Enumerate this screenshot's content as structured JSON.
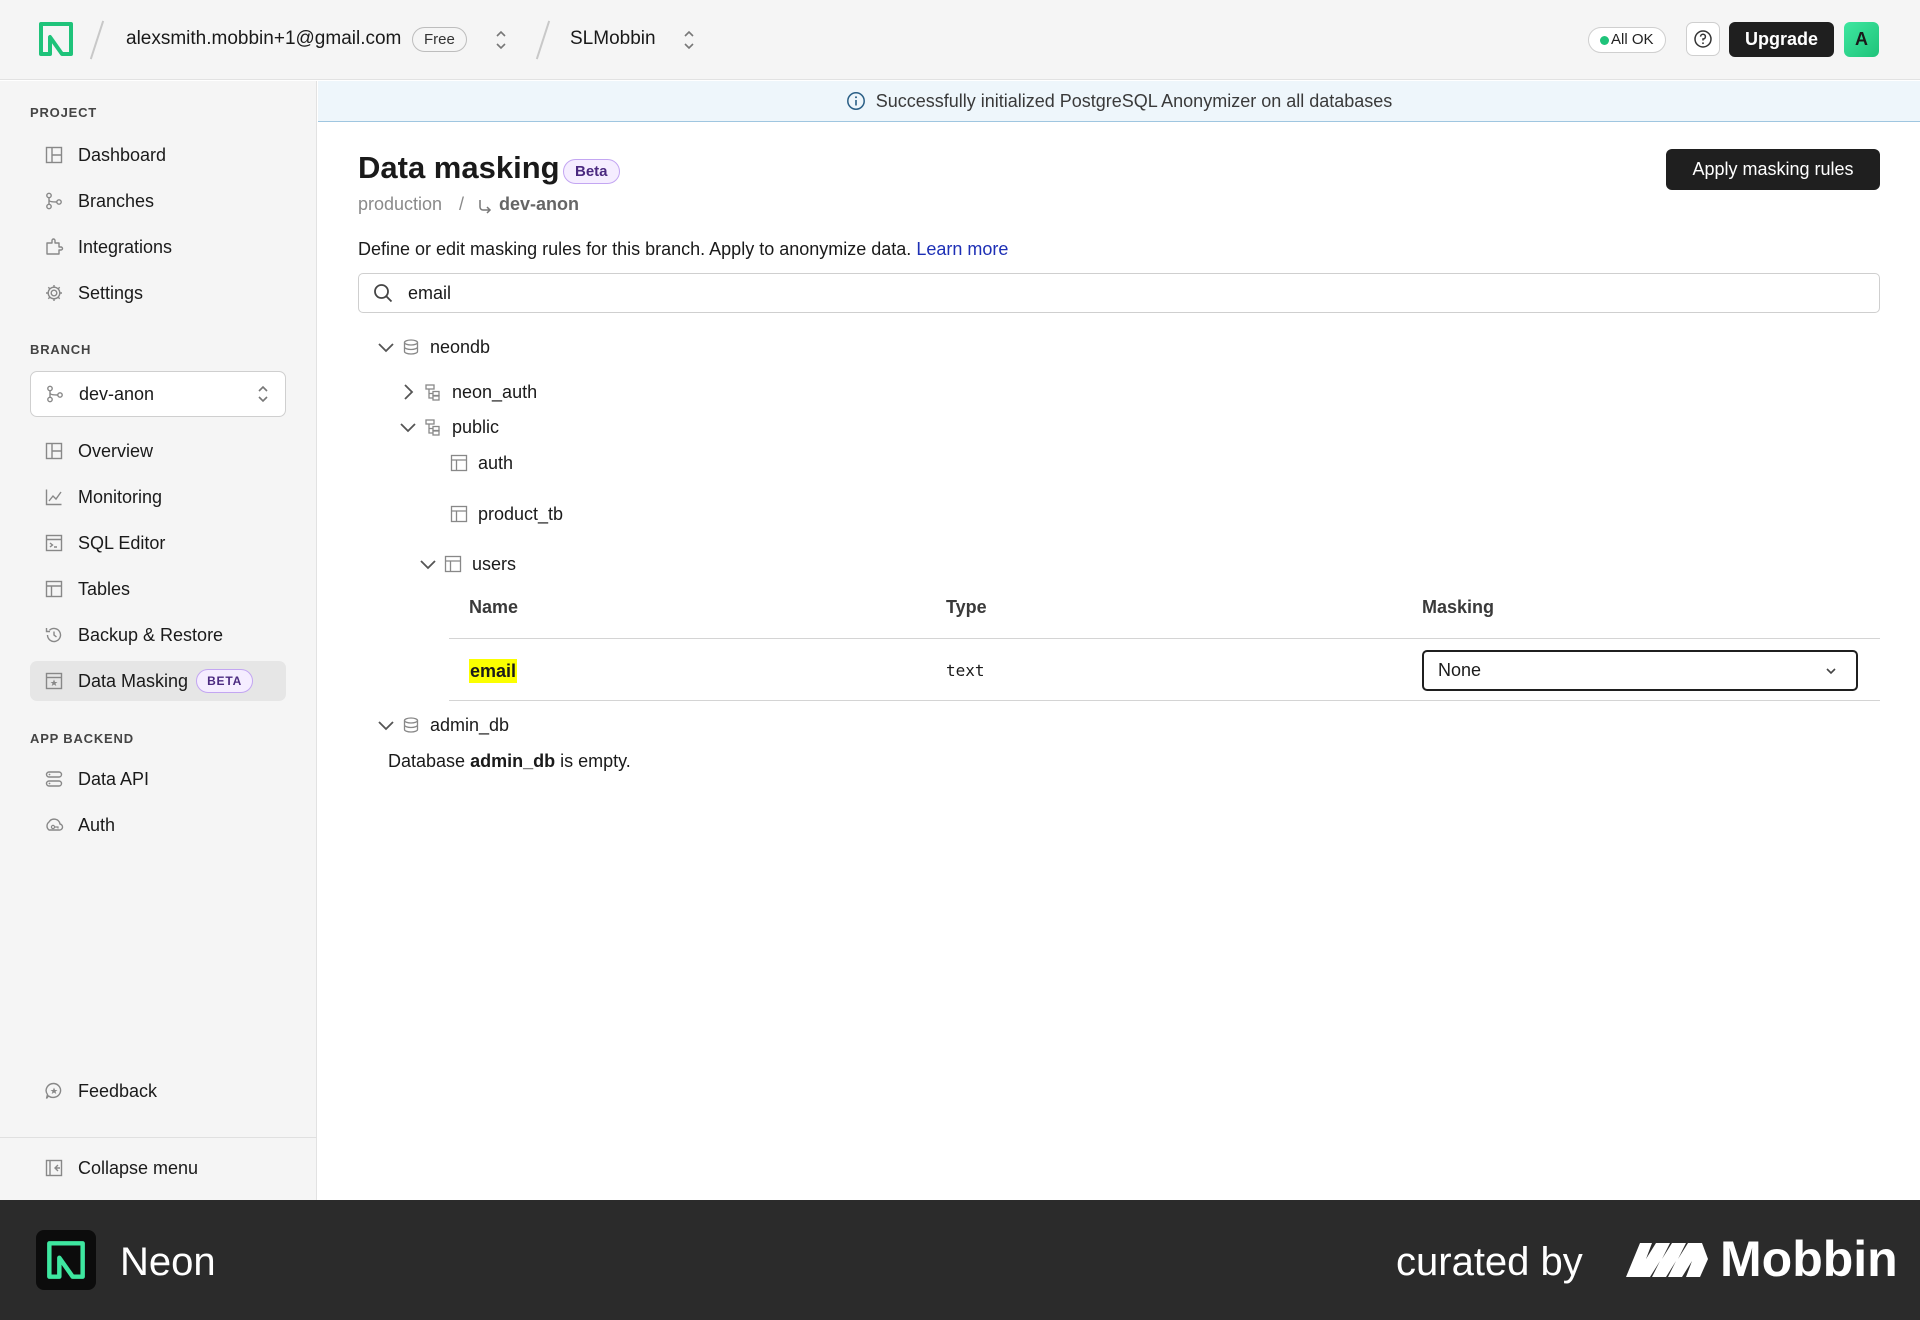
{
  "topbar": {
    "account_email": "alexsmith.mobbin+1@gmail.com",
    "plan_badge": "Free",
    "project_name": "SLMobbin",
    "status_label": "All OK",
    "upgrade_label": "Upgrade",
    "avatar_initial": "A"
  },
  "sidebar": {
    "project_section": "PROJECT",
    "project_items": [
      {
        "label": "Dashboard",
        "icon": "dashboard-icon"
      },
      {
        "label": "Branches",
        "icon": "branches-icon"
      },
      {
        "label": "Integrations",
        "icon": "integrations-icon"
      },
      {
        "label": "Settings",
        "icon": "gear-icon"
      }
    ],
    "branch_section": "BRANCH",
    "branch_select_value": "dev-anon",
    "branch_items": [
      {
        "label": "Overview",
        "icon": "overview-icon"
      },
      {
        "label": "Monitoring",
        "icon": "chart-line-icon"
      },
      {
        "label": "SQL Editor",
        "icon": "terminal-icon"
      },
      {
        "label": "Tables",
        "icon": "table-icon"
      },
      {
        "label": "Backup & Restore",
        "icon": "history-icon"
      },
      {
        "label": "Data Masking",
        "icon": "mask-icon",
        "badge": "BETA",
        "active": true
      }
    ],
    "app_backend_section": "APP BACKEND",
    "app_backend_items": [
      {
        "label": "Data API",
        "icon": "api-icon"
      },
      {
        "label": "Auth",
        "icon": "auth-icon"
      }
    ],
    "feedback_label": "Feedback",
    "collapse_label": "Collapse menu"
  },
  "banner": {
    "message": "Successfully initialized PostgreSQL Anonymizer on all databases"
  },
  "main": {
    "title": "Data masking",
    "title_badge": "Beta",
    "apply_button": "Apply masking rules",
    "breadcrumb_parent": "production",
    "breadcrumb_separator": "/",
    "breadcrumb_branch": "dev-anon",
    "description": "Define or edit masking rules for this branch. Apply to anonymize data.",
    "learn_more": "Learn more",
    "search_value": "email",
    "tree": {
      "db1": "neondb",
      "schema1": "neon_auth",
      "schema2": "public",
      "table1": "auth",
      "table2": "product_tb",
      "table3": "users",
      "db2": "admin_db"
    },
    "columns_table": {
      "headers": [
        "Name",
        "Type",
        "Masking"
      ],
      "rows": [
        {
          "name": "email",
          "type": "text",
          "masking": "None"
        }
      ]
    },
    "empty_prefix": "Database",
    "empty_db": "admin_db",
    "empty_suffix": "is empty."
  },
  "footer": {
    "brand": "Neon",
    "curated_by": "curated by",
    "curator": "Mobbin"
  },
  "colors": {
    "accent_green": "#1fc37a",
    "beta_purple": "#c3a6f2",
    "link_blue": "#1d2fb5",
    "highlight_yellow": "#fbff00",
    "banner_bg": "#eef6fb"
  }
}
